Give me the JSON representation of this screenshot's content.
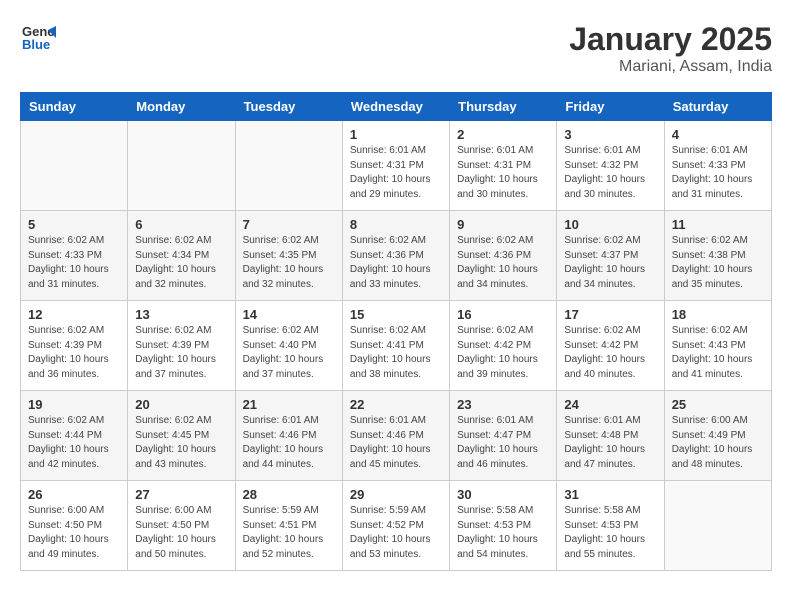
{
  "header": {
    "logo_general": "General",
    "logo_blue": "Blue",
    "title": "January 2025",
    "subtitle": "Mariani, Assam, India"
  },
  "days_of_week": [
    "Sunday",
    "Monday",
    "Tuesday",
    "Wednesday",
    "Thursday",
    "Friday",
    "Saturday"
  ],
  "weeks": [
    {
      "shaded": false,
      "days": [
        {
          "date": "",
          "detail": ""
        },
        {
          "date": "",
          "detail": ""
        },
        {
          "date": "",
          "detail": ""
        },
        {
          "date": "1",
          "detail": "Sunrise: 6:01 AM\nSunset: 4:31 PM\nDaylight: 10 hours\nand 29 minutes."
        },
        {
          "date": "2",
          "detail": "Sunrise: 6:01 AM\nSunset: 4:31 PM\nDaylight: 10 hours\nand 30 minutes."
        },
        {
          "date": "3",
          "detail": "Sunrise: 6:01 AM\nSunset: 4:32 PM\nDaylight: 10 hours\nand 30 minutes."
        },
        {
          "date": "4",
          "detail": "Sunrise: 6:01 AM\nSunset: 4:33 PM\nDaylight: 10 hours\nand 31 minutes."
        }
      ]
    },
    {
      "shaded": true,
      "days": [
        {
          "date": "5",
          "detail": "Sunrise: 6:02 AM\nSunset: 4:33 PM\nDaylight: 10 hours\nand 31 minutes."
        },
        {
          "date": "6",
          "detail": "Sunrise: 6:02 AM\nSunset: 4:34 PM\nDaylight: 10 hours\nand 32 minutes."
        },
        {
          "date": "7",
          "detail": "Sunrise: 6:02 AM\nSunset: 4:35 PM\nDaylight: 10 hours\nand 32 minutes."
        },
        {
          "date": "8",
          "detail": "Sunrise: 6:02 AM\nSunset: 4:36 PM\nDaylight: 10 hours\nand 33 minutes."
        },
        {
          "date": "9",
          "detail": "Sunrise: 6:02 AM\nSunset: 4:36 PM\nDaylight: 10 hours\nand 34 minutes."
        },
        {
          "date": "10",
          "detail": "Sunrise: 6:02 AM\nSunset: 4:37 PM\nDaylight: 10 hours\nand 34 minutes."
        },
        {
          "date": "11",
          "detail": "Sunrise: 6:02 AM\nSunset: 4:38 PM\nDaylight: 10 hours\nand 35 minutes."
        }
      ]
    },
    {
      "shaded": false,
      "days": [
        {
          "date": "12",
          "detail": "Sunrise: 6:02 AM\nSunset: 4:39 PM\nDaylight: 10 hours\nand 36 minutes."
        },
        {
          "date": "13",
          "detail": "Sunrise: 6:02 AM\nSunset: 4:39 PM\nDaylight: 10 hours\nand 37 minutes."
        },
        {
          "date": "14",
          "detail": "Sunrise: 6:02 AM\nSunset: 4:40 PM\nDaylight: 10 hours\nand 37 minutes."
        },
        {
          "date": "15",
          "detail": "Sunrise: 6:02 AM\nSunset: 4:41 PM\nDaylight: 10 hours\nand 38 minutes."
        },
        {
          "date": "16",
          "detail": "Sunrise: 6:02 AM\nSunset: 4:42 PM\nDaylight: 10 hours\nand 39 minutes."
        },
        {
          "date": "17",
          "detail": "Sunrise: 6:02 AM\nSunset: 4:42 PM\nDaylight: 10 hours\nand 40 minutes."
        },
        {
          "date": "18",
          "detail": "Sunrise: 6:02 AM\nSunset: 4:43 PM\nDaylight: 10 hours\nand 41 minutes."
        }
      ]
    },
    {
      "shaded": true,
      "days": [
        {
          "date": "19",
          "detail": "Sunrise: 6:02 AM\nSunset: 4:44 PM\nDaylight: 10 hours\nand 42 minutes."
        },
        {
          "date": "20",
          "detail": "Sunrise: 6:02 AM\nSunset: 4:45 PM\nDaylight: 10 hours\nand 43 minutes."
        },
        {
          "date": "21",
          "detail": "Sunrise: 6:01 AM\nSunset: 4:46 PM\nDaylight: 10 hours\nand 44 minutes."
        },
        {
          "date": "22",
          "detail": "Sunrise: 6:01 AM\nSunset: 4:46 PM\nDaylight: 10 hours\nand 45 minutes."
        },
        {
          "date": "23",
          "detail": "Sunrise: 6:01 AM\nSunset: 4:47 PM\nDaylight: 10 hours\nand 46 minutes."
        },
        {
          "date": "24",
          "detail": "Sunrise: 6:01 AM\nSunset: 4:48 PM\nDaylight: 10 hours\nand 47 minutes."
        },
        {
          "date": "25",
          "detail": "Sunrise: 6:00 AM\nSunset: 4:49 PM\nDaylight: 10 hours\nand 48 minutes."
        }
      ]
    },
    {
      "shaded": false,
      "days": [
        {
          "date": "26",
          "detail": "Sunrise: 6:00 AM\nSunset: 4:50 PM\nDaylight: 10 hours\nand 49 minutes."
        },
        {
          "date": "27",
          "detail": "Sunrise: 6:00 AM\nSunset: 4:50 PM\nDaylight: 10 hours\nand 50 minutes."
        },
        {
          "date": "28",
          "detail": "Sunrise: 5:59 AM\nSunset: 4:51 PM\nDaylight: 10 hours\nand 52 minutes."
        },
        {
          "date": "29",
          "detail": "Sunrise: 5:59 AM\nSunset: 4:52 PM\nDaylight: 10 hours\nand 53 minutes."
        },
        {
          "date": "30",
          "detail": "Sunrise: 5:58 AM\nSunset: 4:53 PM\nDaylight: 10 hours\nand 54 minutes."
        },
        {
          "date": "31",
          "detail": "Sunrise: 5:58 AM\nSunset: 4:53 PM\nDaylight: 10 hours\nand 55 minutes."
        },
        {
          "date": "",
          "detail": ""
        }
      ]
    }
  ]
}
